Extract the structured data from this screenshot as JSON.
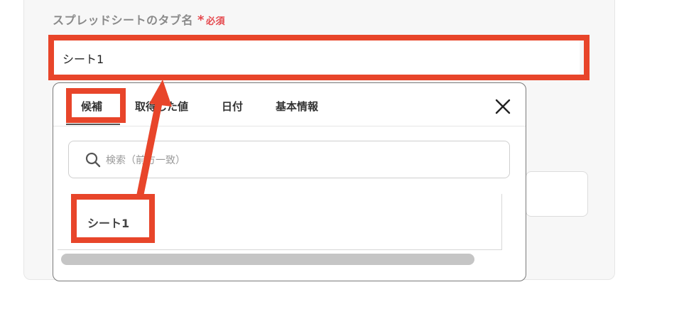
{
  "field": {
    "label": "スプレッドシートのタブ名",
    "required_star": "*",
    "required_text": "必須",
    "value": "シート1"
  },
  "popup": {
    "tabs": [
      {
        "label": "候補"
      },
      {
        "label": "取得した値"
      },
      {
        "label": "日付"
      },
      {
        "label": "基本情報"
      }
    ],
    "close_icon": "close-icon",
    "search": {
      "placeholder": "検索（前方一致）",
      "icon": "search-icon"
    },
    "items": [
      {
        "label": "シート1"
      }
    ]
  },
  "annotation": {
    "color": "#e8452a"
  }
}
